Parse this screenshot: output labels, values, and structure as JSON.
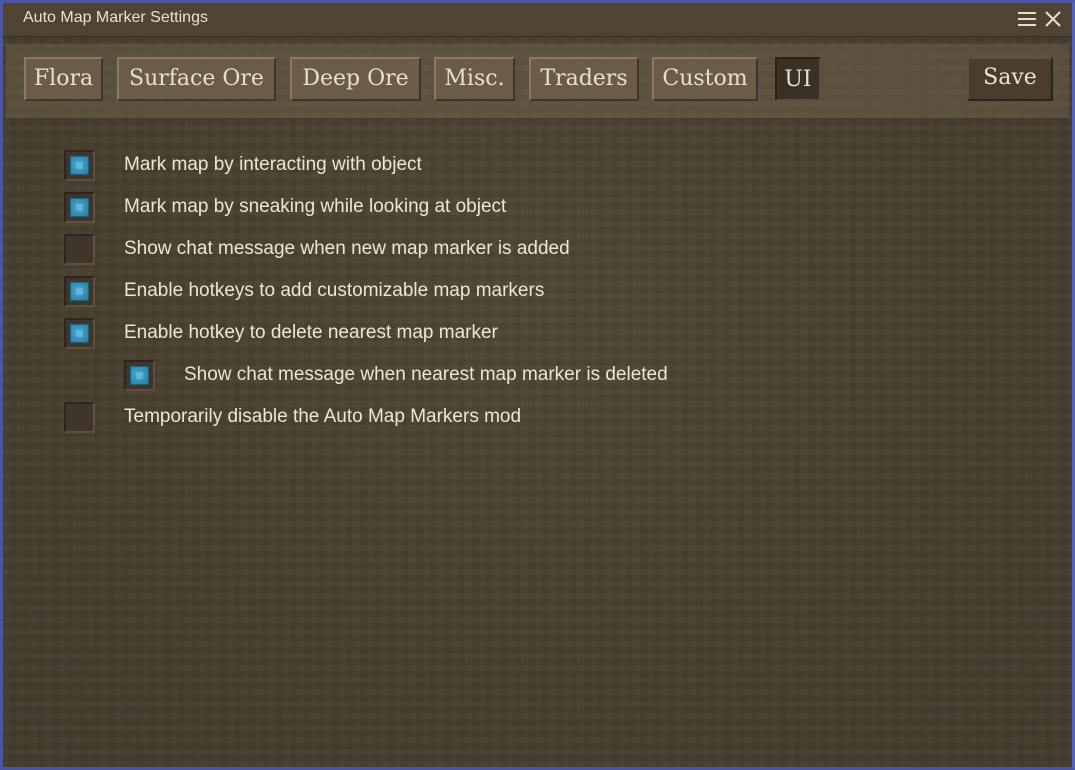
{
  "window": {
    "title": "Auto Map Marker Settings",
    "menu_icon": "hamburger-menu-icon",
    "close_icon": "close-icon"
  },
  "tabs": [
    {
      "label": "Flora",
      "active": false
    },
    {
      "label": "Surface Ore",
      "active": false
    },
    {
      "label": "Deep Ore",
      "active": false
    },
    {
      "label": "Misc.",
      "active": false
    },
    {
      "label": "Traders",
      "active": false
    },
    {
      "label": "Custom",
      "active": false
    },
    {
      "label": "UI",
      "active": true
    }
  ],
  "save_label": "Save",
  "options": [
    {
      "label": "Mark map by interacting with object",
      "checked": true,
      "indent": 0
    },
    {
      "label": "Mark map by sneaking while looking at object",
      "checked": true,
      "indent": 0
    },
    {
      "label": "Show chat message when new map marker is added",
      "checked": false,
      "indent": 0
    },
    {
      "label": "Enable hotkeys to add customizable map markers",
      "checked": true,
      "indent": 0
    },
    {
      "label": "Enable hotkey to delete nearest map marker",
      "checked": true,
      "indent": 0
    },
    {
      "label": "Show chat message when nearest map marker is deleted",
      "checked": true,
      "indent": 1
    },
    {
      "label": "Temporarily disable the Auto Map Markers mod",
      "checked": false,
      "indent": 0
    }
  ],
  "colors": {
    "checkbox_checked": "#3a96c0",
    "panel_background": "#4b4131",
    "window_border": "#4a55a8"
  }
}
